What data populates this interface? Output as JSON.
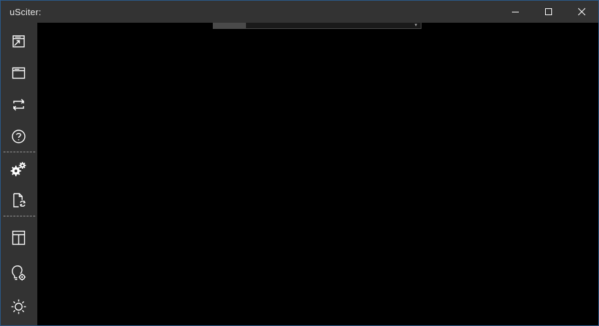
{
  "window": {
    "title": "uSciter:",
    "controls": [
      {
        "name": "minimize",
        "icon": "minimize-icon"
      },
      {
        "name": "maximize",
        "icon": "maximize-icon"
      },
      {
        "name": "close",
        "icon": "close-icon"
      }
    ]
  },
  "sidebar": {
    "groups": [
      [
        "open-window-icon",
        "window-icon",
        "refresh-icon",
        "help-icon"
      ],
      [
        "settings-gears-icon",
        "document-refresh-icon"
      ],
      [
        "layout-grid-icon",
        "bulb-settings-icon",
        "brightness-icon"
      ]
    ]
  },
  "colors": {
    "titlebar": "#333333",
    "sidebar": "#333333",
    "content": "#000000",
    "icon": "#ffffff",
    "border": "#2a5a8a"
  }
}
